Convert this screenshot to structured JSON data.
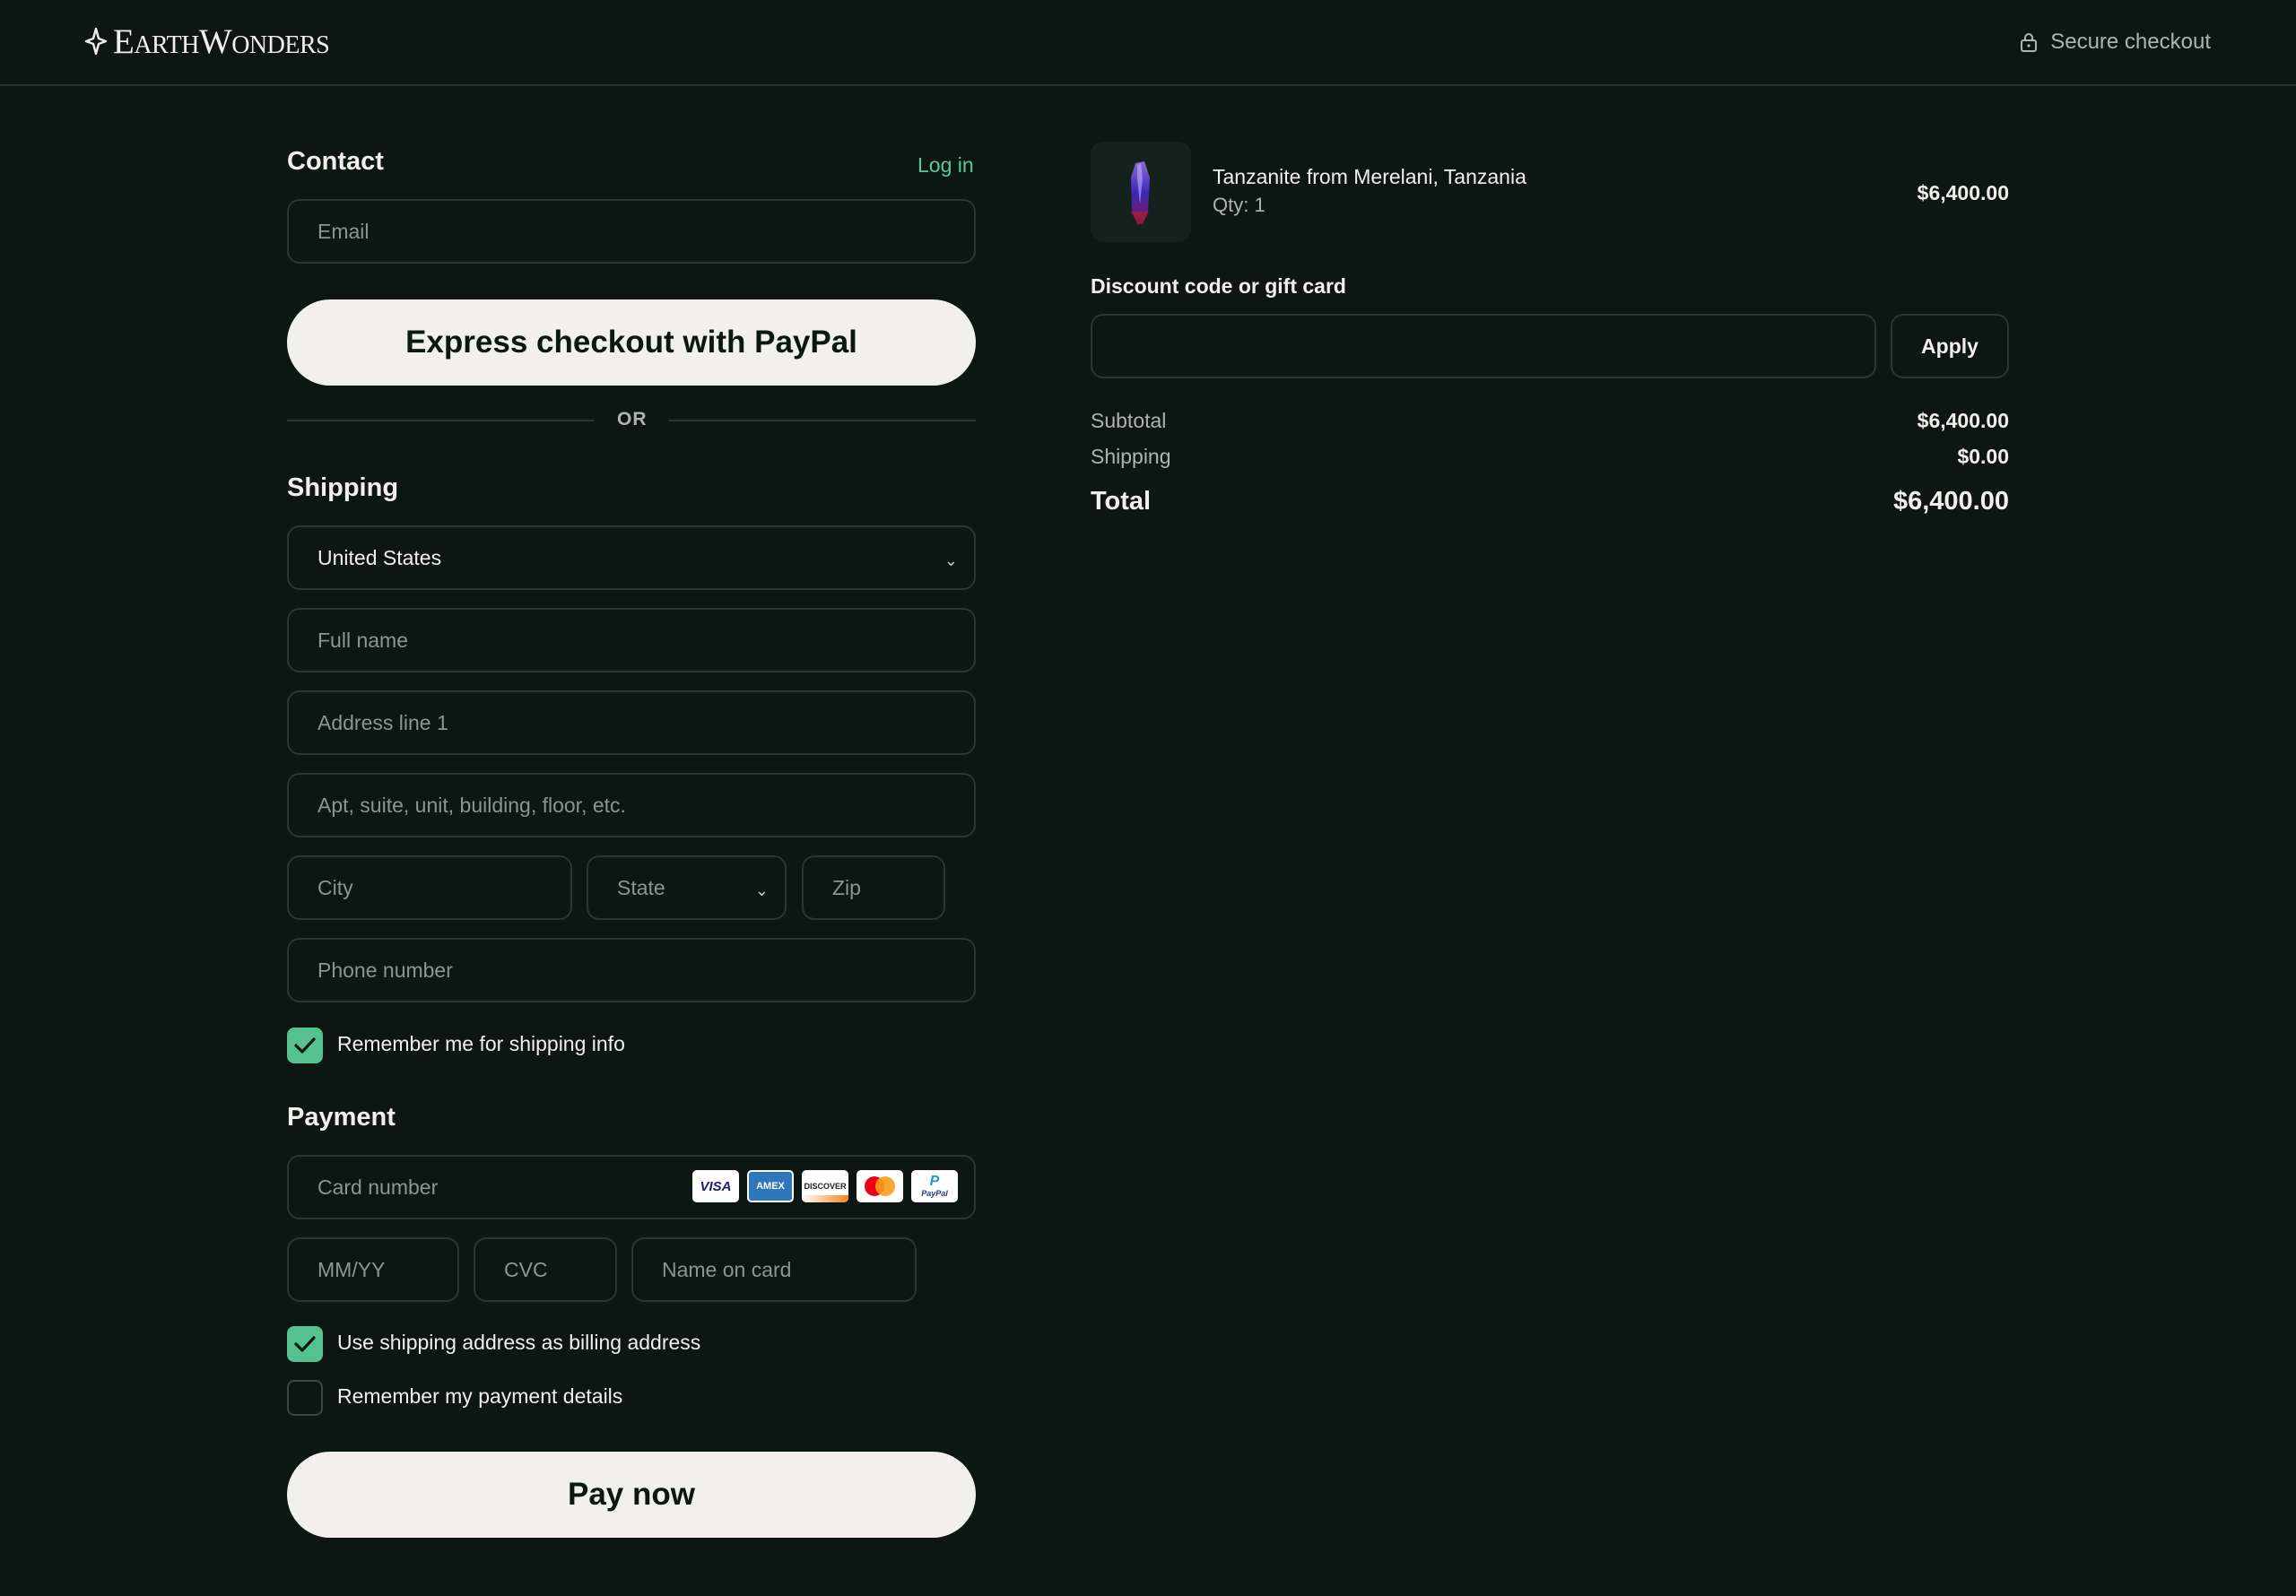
{
  "header": {
    "brand": {
      "big_e": "E",
      "arth": "ARTH",
      "big_w": "W",
      "onders": "ONDERS"
    },
    "secure_label": "Secure checkout"
  },
  "contact": {
    "title": "Contact",
    "login_label": "Log in",
    "email_placeholder": "Email"
  },
  "express": {
    "label": "Express checkout with PayPal",
    "or_label": "OR"
  },
  "shipping": {
    "title": "Shipping",
    "country_value": "United States",
    "full_name_placeholder": "Full name",
    "address1_placeholder": "Address line 1",
    "address2_placeholder": "Apt, suite, unit, building, floor, etc.",
    "city_placeholder": "City",
    "state_placeholder": "State",
    "zip_placeholder": "Zip",
    "phone_placeholder": "Phone number",
    "remember_label": "Remember me for shipping info",
    "remember_checked": true
  },
  "payment": {
    "title": "Payment",
    "card_placeholder": "Card number",
    "card_brands": [
      "visa-icon",
      "amex-icon",
      "discover-icon",
      "mastercard-icon",
      "paypal-icon"
    ],
    "card_brand_text": {
      "visa": "VISA",
      "amex": "AMEX",
      "discover": "DISCOVER",
      "paypal_p": "P",
      "paypal": "PayPal"
    },
    "expiry_placeholder": "MM/YY",
    "cvc_placeholder": "CVC",
    "name_placeholder": "Name on card",
    "billing_label": "Use shipping address as billing address",
    "billing_checked": true,
    "remember_payment_label": "Remember my payment details",
    "remember_payment_checked": false,
    "pay_label": "Pay now"
  },
  "summary": {
    "item": {
      "title": "Tanzanite from Merelani, Tanzania",
      "qty": "Qty: 1",
      "price": "$6,400.00"
    },
    "discount_label": "Discount code or gift card",
    "discount_value": "",
    "apply_label": "Apply",
    "subtotal_label": "Subtotal",
    "subtotal_value": "$6,400.00",
    "shipping_label": "Shipping",
    "shipping_value": "$0.00",
    "total_label": "Total",
    "total_value": "$6,400.00"
  },
  "colors": {
    "background": "#0c1613",
    "accent_green": "#55c18f",
    "link_green": "#5cc79a",
    "button_light": "#f1f0ec"
  }
}
